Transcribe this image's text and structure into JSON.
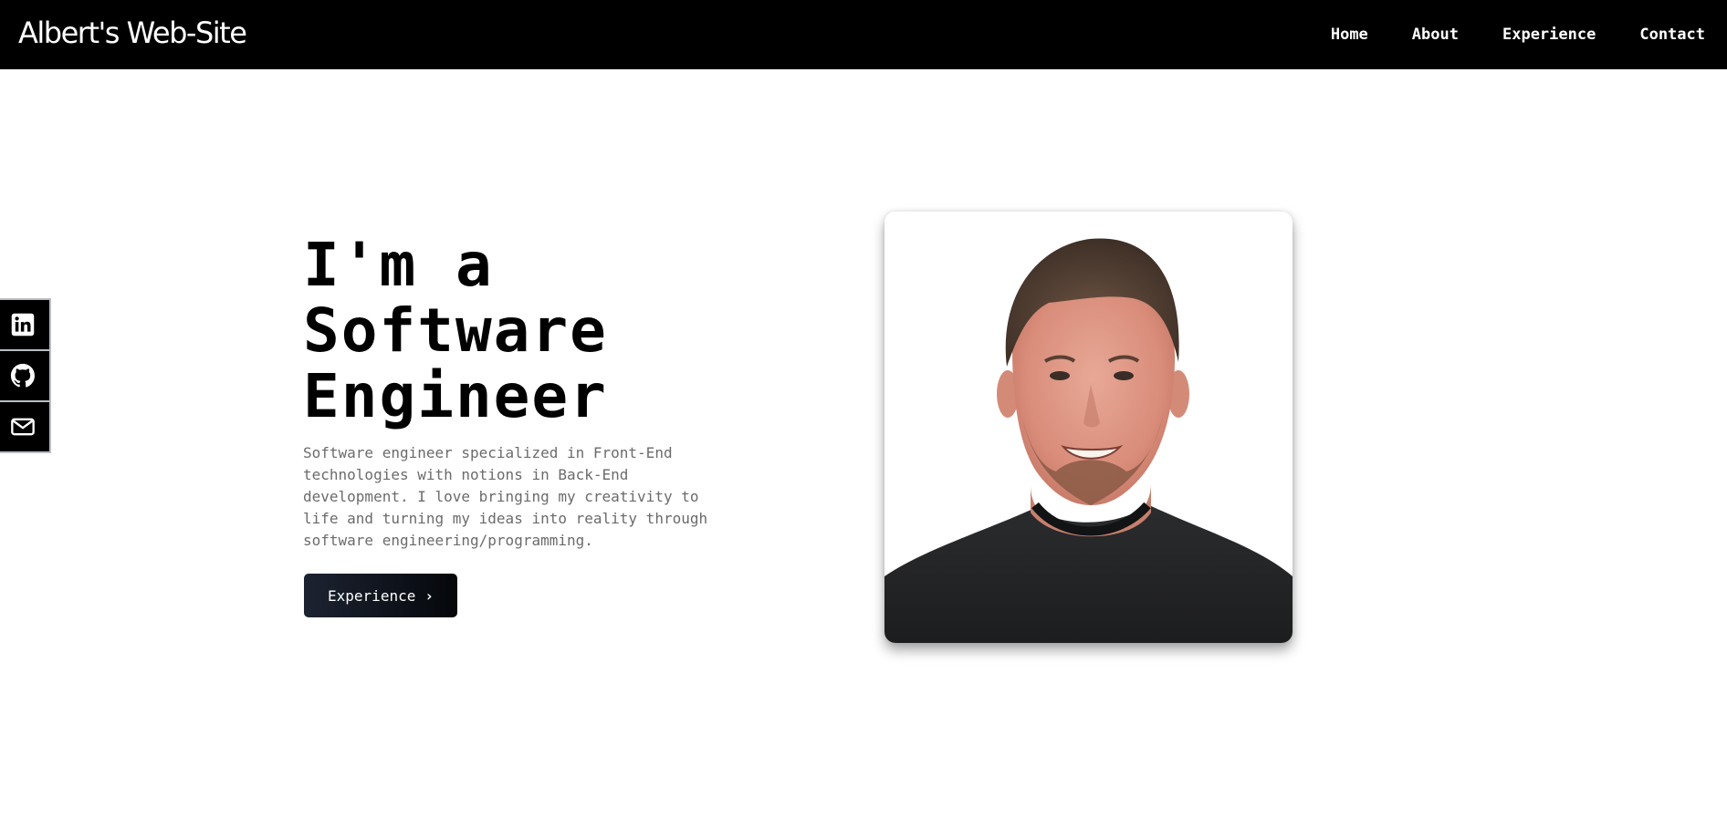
{
  "header": {
    "brand": "Albert's Web-Site",
    "nav": [
      {
        "label": "Home"
      },
      {
        "label": "About"
      },
      {
        "label": "Experience"
      },
      {
        "label": "Contact"
      }
    ]
  },
  "social": [
    {
      "icon": "linkedin-icon"
    },
    {
      "icon": "github-icon"
    },
    {
      "icon": "mail-icon"
    }
  ],
  "hero": {
    "title_lines": [
      "I'm a",
      "Software",
      "Engineer"
    ],
    "description_lines": [
      "Software engineer specialized in Front-End",
      "technologies with notions in Back-End",
      "development. I love bringing my creativity to",
      "life and turning my ideas into reality through",
      "software engineering/programming."
    ],
    "cta_label": "Experience",
    "cta_icon": "chevron-right-icon"
  },
  "colors": {
    "header_bg": "#000000",
    "text_primary": "#000000",
    "text_muted": "#6b6b6b",
    "button_gradient_start": "#1c2331",
    "button_gradient_end": "#05070b"
  }
}
